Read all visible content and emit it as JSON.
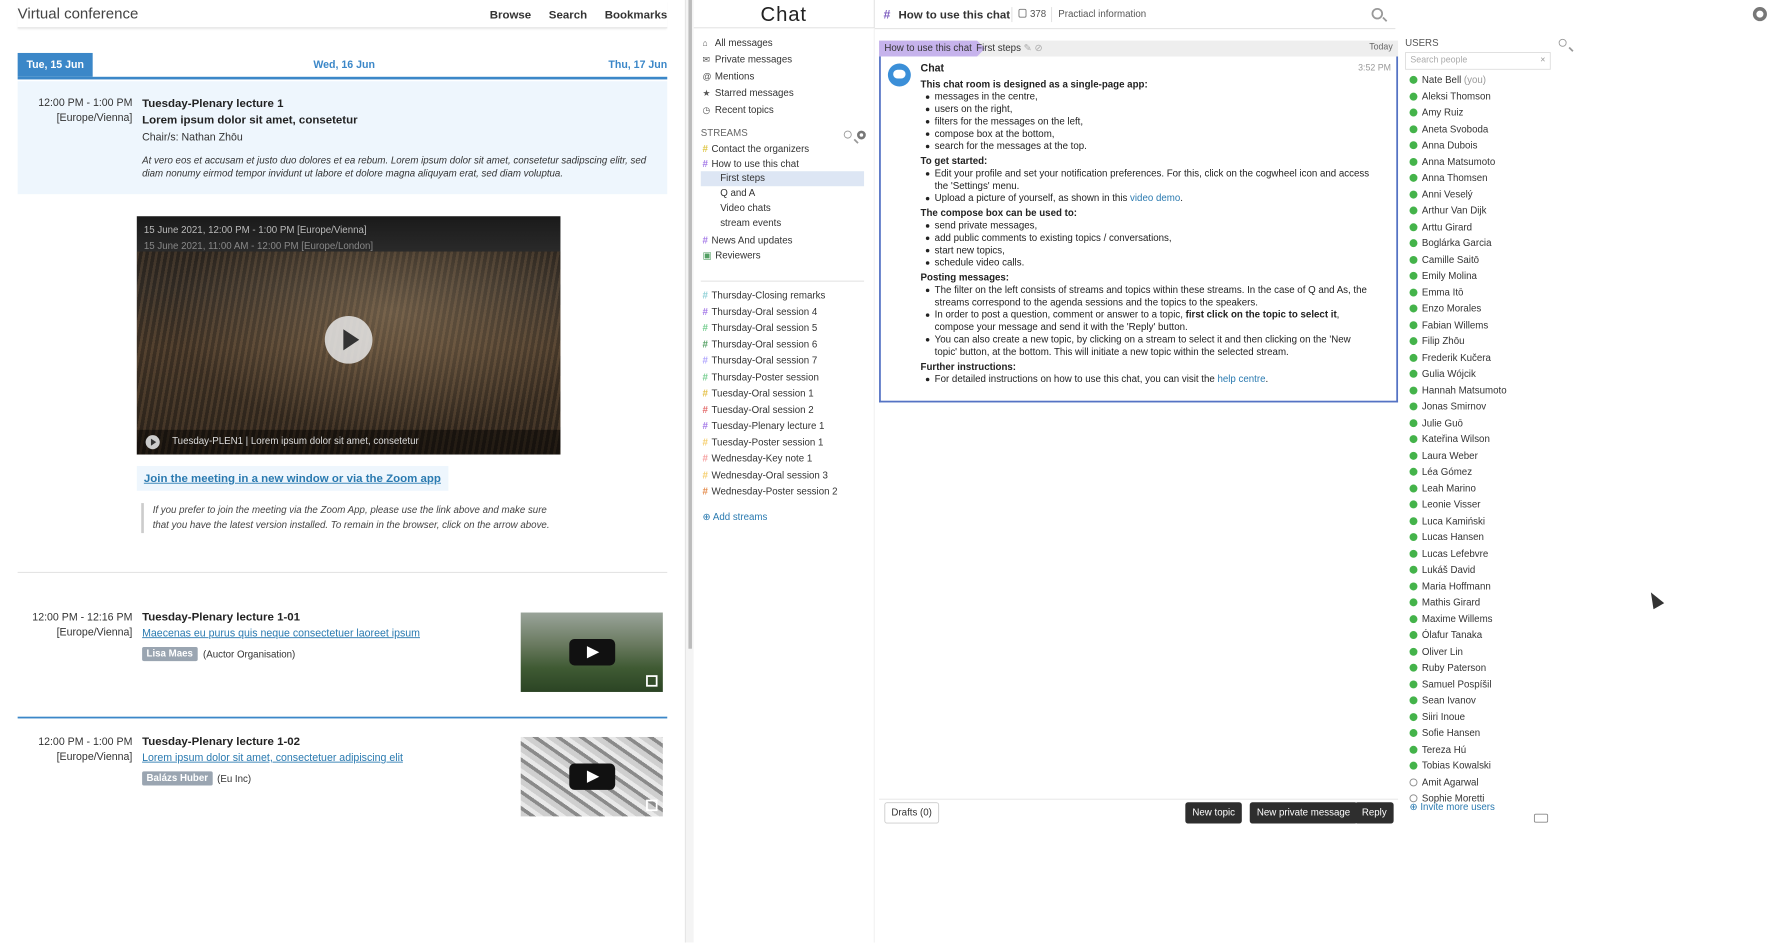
{
  "conf": {
    "title": "Virtual conference",
    "nav": [
      "Browse",
      "Search",
      "Bookmarks"
    ],
    "days": [
      "Tue, 15 Jun",
      "Wed, 16 Jun",
      "Thu, 17 Jun"
    ],
    "session1": {
      "time": "12:00 PM - 1:00 PM",
      "tz": "[Europe/Vienna]",
      "title": "Tuesday-Plenary lecture 1",
      "subtitle": "Lorem ipsum dolor sit amet, consetetur",
      "chair": "Chair/s: Nathan Zhōu",
      "desc": "At vero eos et accusam et justo duo dolores et ea rebum. Lorem ipsum dolor sit amet, consetetur sadipscing elitr, sed diam nonumy eirmod tempor invidunt ut labore et dolore magna aliquyam erat, sed diam voluptua."
    },
    "video": {
      "overlay1": "15 June 2021, 12:00 PM - 1:00 PM [Europe/Vienna]",
      "overlay2": "15 June 2021, 11:00 AM - 12:00 PM [Europe/London]",
      "caption": "Tuesday-PLEN1 | Lorem ipsum dolor sit amet, consetetur"
    },
    "join_link": "Join the meeting in a new window or via the Zoom app",
    "note": "If you prefer to join the meeting via the Zoom App, please use the link above and make sure that you have the latest version installed. To remain in the browser, click on the arrow above.",
    "talks": [
      {
        "time": "12:00 PM - 12:16 PM",
        "tz": "[Europe/Vienna]",
        "title": "Tuesday-Plenary lecture 1-01",
        "link": "Maecenas eu purus quis neque consectetuer laoreet ipsum",
        "speaker": "Lisa Maes",
        "org": "(Auctor Organisation)"
      },
      {
        "time": "12:00 PM - 1:00 PM",
        "tz": "[Europe/Vienna]",
        "title": "Tuesday-Plenary lecture 1-02",
        "link": "Lorem ipsum dolor sit amet, consectetuer adipiscing elit",
        "speaker": "Balázs Huber",
        "org": "(Eu Inc)"
      }
    ]
  },
  "chat": {
    "logo": "Chat",
    "topbar": {
      "stream": "How to use this chat",
      "count": "378",
      "desc": "Practiacl information"
    },
    "nav": [
      "All messages",
      "Private messages",
      "Mentions",
      "Starred messages",
      "Recent topics"
    ],
    "streams_label": "STREAMS",
    "streams_top": [
      {
        "name": "Contact the organizers",
        "color": "#e0c84a",
        "icon": "#"
      },
      {
        "name": "How to use this chat",
        "color": "#a67ce8",
        "icon": "#"
      }
    ],
    "topics": [
      "First steps",
      "Q and A",
      "Video chats",
      "stream events"
    ],
    "streams_mid": [
      {
        "name": "News And updates",
        "color": "#a67ce8",
        "icon": "#"
      },
      {
        "name": "Reviewers",
        "color": "#53a063",
        "icon": "lock"
      }
    ],
    "streams_bottom": [
      {
        "name": "Thursday-Closing remarks",
        "color": "#8fd0d6"
      },
      {
        "name": "Thursday-Oral session 4",
        "color": "#a67ce8"
      },
      {
        "name": "Thursday-Oral session 5",
        "color": "#76ce90"
      },
      {
        "name": "Thursday-Oral session 6",
        "color": "#53a063"
      },
      {
        "name": "Thursday-Oral session 7",
        "color": "#b0a5fd"
      },
      {
        "name": "Thursday-Poster session",
        "color": "#76ce90"
      },
      {
        "name": "Tuesday-Oral session 1",
        "color": "#e4c14a"
      },
      {
        "name": "Tuesday-Oral session 2",
        "color": "#e46f6f"
      },
      {
        "name": "Tuesday-Plenary lecture 1",
        "color": "#a67ce8"
      },
      {
        "name": "Tuesday-Poster session 1",
        "color": "#f5ce6e"
      },
      {
        "name": "Wednesday-Key note 1",
        "color": "#f5a0a0"
      },
      {
        "name": "Wednesday-Oral session 3",
        "color": "#f5ce6e"
      },
      {
        "name": "Wednesday-Poster session 2",
        "color": "#e48a4a"
      }
    ],
    "add_streams": "Add streams",
    "recipient": {
      "stream": "How to use this chat",
      "topic": "First steps",
      "date": "Today"
    },
    "message": {
      "sender": "Chat",
      "time": "3:52 PM",
      "intro": "This chat room is designed as a single-page app:",
      "intro_items": [
        "messages in the centre,",
        "users on the right,",
        "filters for the messages on the left,",
        "compose box at the bottom,",
        "search for the messages at the top."
      ],
      "start_h": "To get started:",
      "start_items": [
        "Edit your profile and set your notification preferences. For this, click on the cogwheel icon and access the 'Settings' menu."
      ],
      "upload_pre": "Upload a picture of yourself, as shown in this ",
      "upload_link": "video demo",
      "compose_h": "The compose box can be used to:",
      "compose_items": [
        "send private messages,",
        "add public comments to existing topics / conversations,",
        "start new topics,",
        "schedule video calls."
      ],
      "posting_h": "Posting messages:",
      "posting_1": "The filter on the left consists of streams and topics within these streams. In the case of Q and As, the streams correspond to the agenda sessions and the topics to the speakers.",
      "posting_2_pre": "In order to post a question, comment or answer to a topic, ",
      "posting_2_bold": "first click on the topic to select it",
      "posting_2_post": ", compose your message and send it with the 'Reply' button.",
      "posting_3": "You can also create a new topic, by clicking on a stream to select it and then clicking on the 'New topic' button, at the bottom. This will initiate a new topic within the selected stream.",
      "further_h": "Further instructions:",
      "further_pre": "For detailed instructions on how to use this chat, you can visit the ",
      "further_link": "help centre"
    },
    "compose": {
      "drafts": "Drafts (0)",
      "new_topic": "New topic",
      "new_pm": "New private message",
      "reply": "Reply"
    },
    "users_label": "USERS",
    "users_search": "Search people",
    "users": [
      "Nate Bell",
      "Aleksi Thomson",
      "Amy Ruiz",
      "Aneta Svoboda",
      "Anna Dubois",
      "Anna Matsumoto",
      "Anna Thomsen",
      "Anni Veselý",
      "Arthur Van Dijk",
      "Arttu Girard",
      "Boglárka Garcia",
      "Camille Saitō",
      "Emily Molina",
      "Emma Itō",
      "Enzo Morales",
      "Fabian Willems",
      "Filip Zhōu",
      "Frederik Kučera",
      "Gulia Wójcik",
      "Hannah Matsumoto",
      "Jonas Smirnov",
      "Julie Guō",
      "Kateřina Wilson",
      "Laura Weber",
      "Léa Gómez",
      "Leah Marino",
      "Leonie Visser",
      "Luca Kamiński",
      "Lucas Hansen",
      "Lucas Lefebvre",
      "Lukáš David",
      "Maria Hoffmann",
      "Mathis Girard",
      "Maxime Willems",
      "Ólafur Tanaka",
      "Oliver Lin",
      "Ruby Paterson",
      "Samuel Pospíšil",
      "Sean Ivanov",
      "Siiri Inoue",
      "Sofie Hansen",
      "Tereza Hú",
      "Tobias Kowalski",
      "Amit Agarwal",
      "Sophie Moretti"
    ],
    "you_label": "(you)",
    "invite": "Invite more users"
  }
}
